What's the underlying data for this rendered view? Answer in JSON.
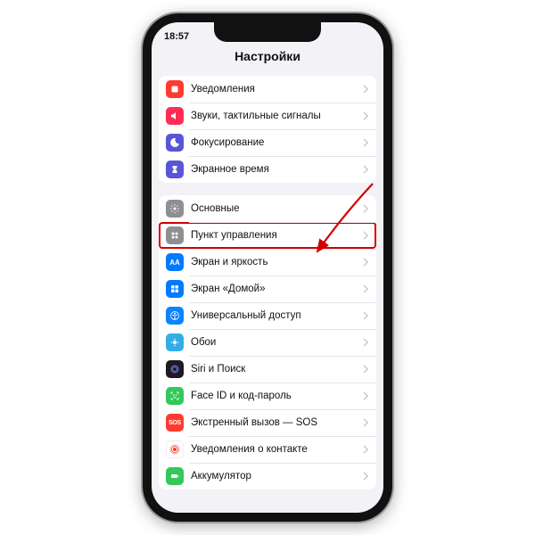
{
  "status": {
    "time": "18:57"
  },
  "header": {
    "title": "Настройки"
  },
  "groups": [
    {
      "items": [
        {
          "id": "notifications",
          "label": "Уведомления"
        },
        {
          "id": "sounds",
          "label": "Звуки, тактильные сигналы"
        },
        {
          "id": "focus",
          "label": "Фокусирование"
        },
        {
          "id": "screentime",
          "label": "Экранное время"
        }
      ]
    },
    {
      "items": [
        {
          "id": "general",
          "label": "Основные"
        },
        {
          "id": "control-center",
          "label": "Пункт управления",
          "highlight": true
        },
        {
          "id": "display",
          "label": "Экран и яркость"
        },
        {
          "id": "home",
          "label": "Экран «Домой»"
        },
        {
          "id": "accessibility",
          "label": "Универсальный доступ"
        },
        {
          "id": "wallpaper",
          "label": "Обои"
        },
        {
          "id": "siri",
          "label": "Siri и Поиск"
        },
        {
          "id": "faceid",
          "label": "Face ID и код-пароль"
        },
        {
          "id": "sos",
          "label": "Экстренный вызов — SOS"
        },
        {
          "id": "contact-notif",
          "label": "Уведомления о контакте"
        },
        {
          "id": "battery",
          "label": "Аккумулятор"
        }
      ]
    }
  ]
}
